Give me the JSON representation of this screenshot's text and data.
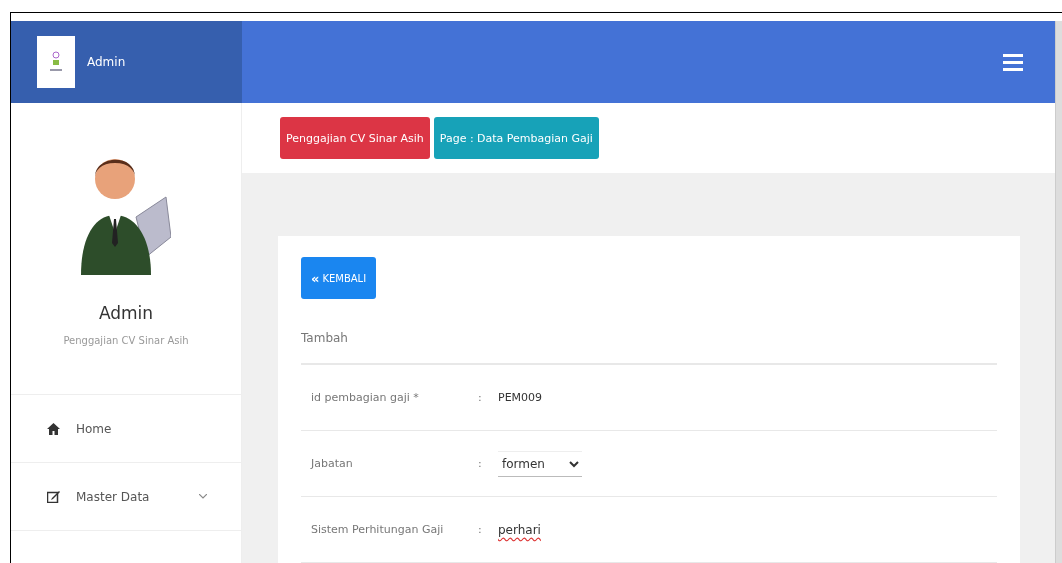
{
  "header": {
    "brand": "Admin"
  },
  "profile": {
    "name": "Admin",
    "subtitle": "Penggajian CV Sinar Asih"
  },
  "sidebar": {
    "items": [
      {
        "label": "Home",
        "kind": "link"
      },
      {
        "label": "Master Data",
        "kind": "dropdown",
        "expanded": false
      }
    ]
  },
  "breadcrumb": [
    {
      "label": "Penggajian CV Sinar Asih",
      "kind": "danger"
    },
    {
      "label": "Page : Data Pembagian Gaji",
      "kind": "info"
    }
  ],
  "back_button": {
    "icon": "«",
    "label": "KEMBALI"
  },
  "form": {
    "title": "Tambah",
    "rows": [
      {
        "label": "id pembagian gaji *",
        "kind": "text",
        "separator": ":",
        "value": "PEM009"
      },
      {
        "label": "Jabatan",
        "kind": "select",
        "separator": ":",
        "value": "formen"
      },
      {
        "label": "Sistem Perhitungan Gaji",
        "kind": "spell",
        "separator": ":",
        "value": "perhari"
      }
    ]
  }
}
